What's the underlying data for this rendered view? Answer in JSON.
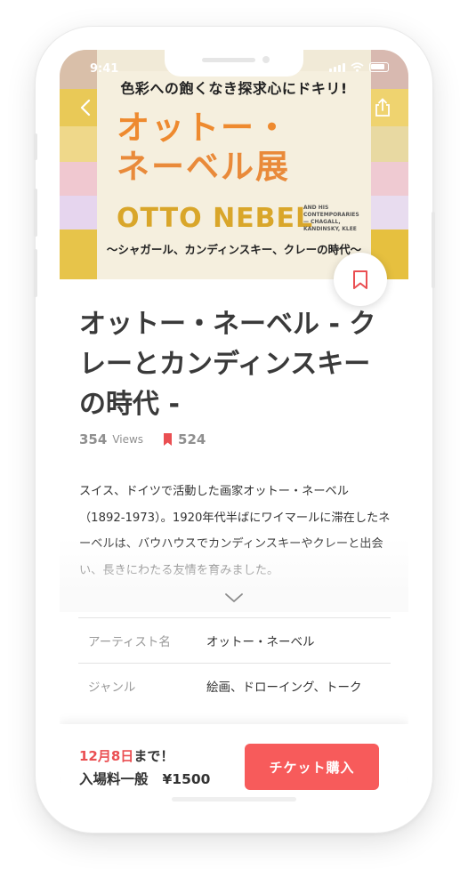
{
  "status_bar": {
    "time": "9:41"
  },
  "banner": {
    "headline": "色彩への飽くなき探求心にドキリ!",
    "title_line1": "オットー・",
    "title_line2": "ネーベル展",
    "title_latin": "OTTO NEBEL",
    "small_text": "AND HIS CONTEMPORARIES — CHAGALL, KANDINSKY, KLEE",
    "subtitle": "〜シャガール、カンディンスキー、クレーの時代〜"
  },
  "event": {
    "title": "オットー・ネーベル - クレーとカンディンスキーの時代 -",
    "views_count": "354",
    "views_label": "Views",
    "bookmark_count": "524",
    "description": "スイス、ドイツで活動した画家オットー・ネーベル（1892-1973）。1920年代半ばにワイマールに滞在したネーベルは、バウハウスでカンディンスキーやクレーと出会い、長きにわたる友情を育みました。"
  },
  "details": [
    {
      "label": "アーティスト名",
      "value": "オットー・ネーベル"
    },
    {
      "label": "ジャンル",
      "value": "絵画、ドローイング、トーク"
    }
  ],
  "purchase": {
    "deadline_date": "12月8日",
    "deadline_suffix": "まで！",
    "price_label": "入場料一般",
    "price_value": "¥1500",
    "button_label": "チケット購入"
  },
  "colors": {
    "accent": "#f75b5b",
    "deadline": "#ea4f52",
    "bookmark_icon": "#ea4f52"
  },
  "icons": [
    "back-chevron-icon",
    "share-icon",
    "bookmark-icon",
    "chevron-down-icon"
  ]
}
